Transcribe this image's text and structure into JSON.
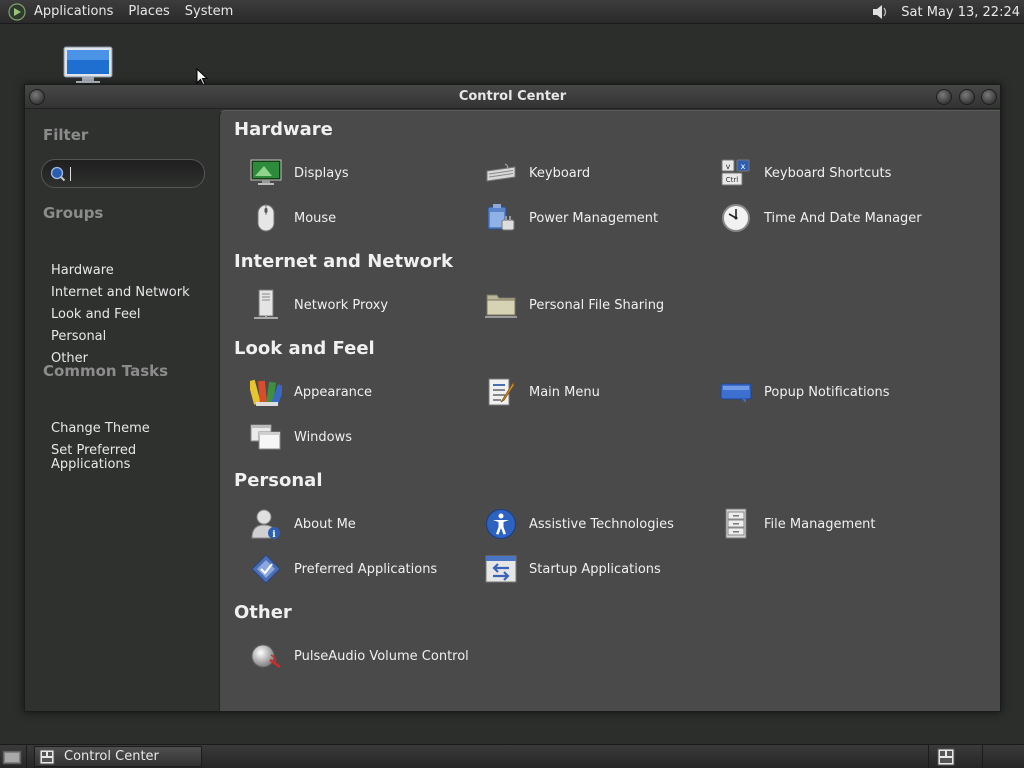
{
  "top_panel": {
    "menus": [
      "Applications",
      "Places",
      "System"
    ],
    "clock": "Sat May 13, 22:24",
    "icons": {
      "logo": "gnome-foot-icon",
      "volume": "speaker-icon"
    }
  },
  "window": {
    "title": "Control Center"
  },
  "sidebar": {
    "filter_heading": "Filter",
    "search": {
      "value": "",
      "placeholder": ""
    },
    "groups_heading": "Groups",
    "groups": [
      "Hardware",
      "Internet and Network",
      "Look and Feel",
      "Personal",
      "Other"
    ],
    "tasks_heading": "Common Tasks",
    "tasks": [
      "Change Theme",
      "Set Preferred Applications"
    ]
  },
  "sections": {
    "hardware": {
      "title": "Hardware",
      "items": [
        "Displays",
        "Keyboard",
        "Keyboard Shortcuts",
        "Mouse",
        "Power Management",
        "Time And Date Manager"
      ]
    },
    "internet": {
      "title": "Internet and Network",
      "items": [
        "Network Proxy",
        "Personal File Sharing"
      ]
    },
    "look": {
      "title": "Look and Feel",
      "items": [
        "Appearance",
        "Main Menu",
        "Popup Notifications",
        "Windows"
      ]
    },
    "personal": {
      "title": "Personal",
      "items": [
        "About Me",
        "Assistive Technologies",
        "File Management",
        "Preferred Applications",
        "Startup Applications"
      ]
    },
    "other": {
      "title": "Other",
      "items": [
        "PulseAudio Volume Control"
      ]
    }
  },
  "bottom_panel": {
    "task_label": "Control Center"
  },
  "colors": {
    "panel": "#2e2e2e",
    "sidebar": "#2f312f",
    "content": "#4a4a4a",
    "text": "#f0f0f0",
    "muted_heading": "#8c8c8c"
  }
}
